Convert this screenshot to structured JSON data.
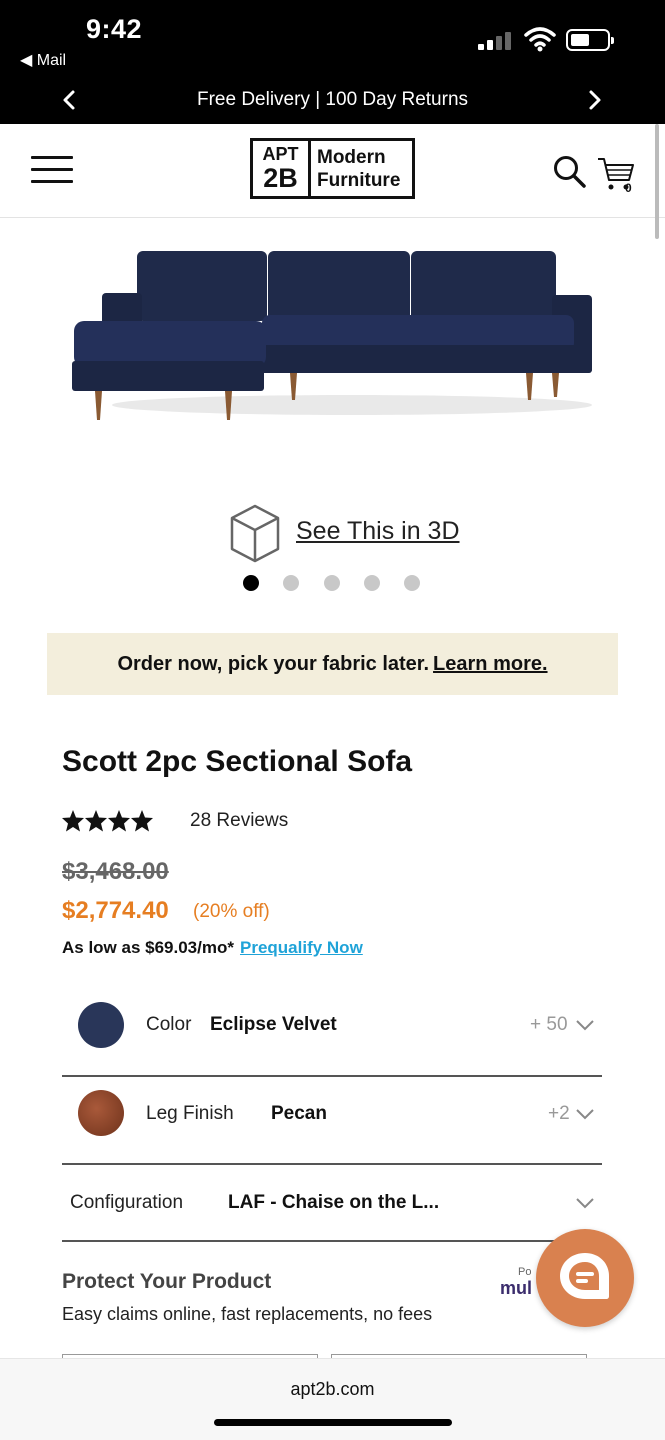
{
  "status_bar": {
    "time": "9:42",
    "back_app": "◀ Mail"
  },
  "promo": {
    "text": "Free Delivery | 100 Day Returns"
  },
  "header": {
    "logo_left_top": "APT",
    "logo_left_bottom": "2B",
    "logo_right_top": "Modern",
    "logo_right_bottom": "Furniture",
    "cart_count": "0"
  },
  "view3d": {
    "label": "See This in 3D"
  },
  "carousel": {
    "count": 5,
    "active_index": 0
  },
  "notice": {
    "text": "Order now, pick your fabric later.",
    "link": "Learn more."
  },
  "product": {
    "title": "Scott 2pc Sectional Sofa",
    "rating": 4.8,
    "reviews": "28 Reviews",
    "old_price": "$3,468.00",
    "sale_price": "$2,774.40",
    "discount": "(20% off)",
    "finance_text": "As low as $69.03/mo*",
    "finance_link": "Prequalify Now"
  },
  "options": {
    "color": {
      "label": "Color",
      "value": "Eclipse Velvet",
      "count": "+ 50",
      "swatch": "#293659"
    },
    "leg_finish": {
      "label": "Leg Finish",
      "value": "Pecan",
      "count": "+2",
      "swatch": "#8a4427"
    },
    "configuration": {
      "label": "Configuration",
      "value": "LAF - Chaise on the L..."
    }
  },
  "protect": {
    "title": "Protect Your Product",
    "subtitle": "Easy claims online, fast replacements, no fees",
    "powered_by": "Po",
    "brand": "mul"
  },
  "bottom": {
    "url": "apt2b.com"
  },
  "colors": {
    "accent": "#e67e22",
    "link": "#1fa3d8",
    "chat": "#d9814f",
    "notice_bg": "#f3eedc"
  }
}
